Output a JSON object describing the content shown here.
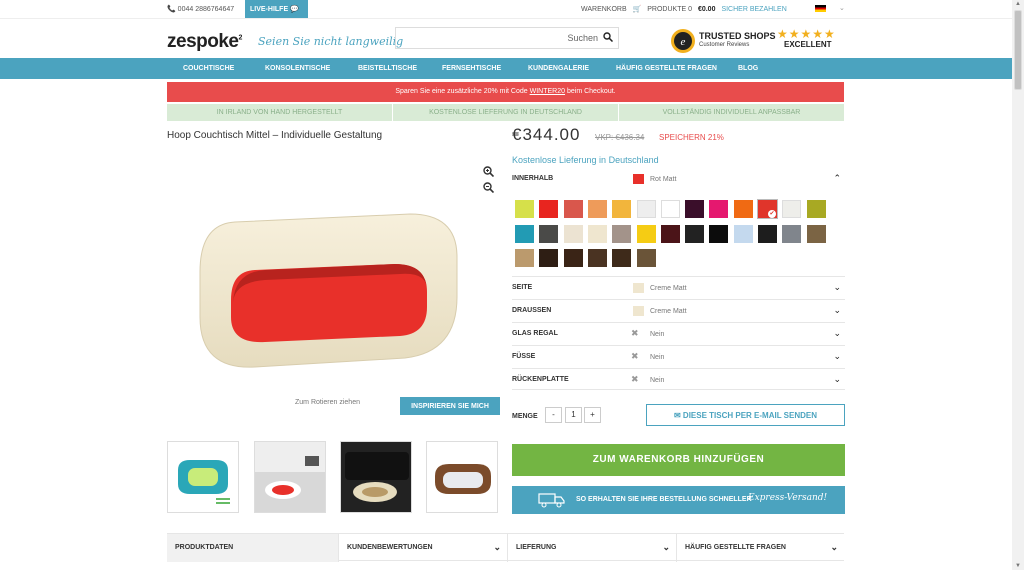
{
  "topbar": {
    "phone": "0044 2886764647",
    "live_label": "LIVE-HILFE",
    "cart_label": "WARENKORB",
    "products_label": "PRODUKTE 0",
    "total": "€0.00",
    "checkout_label": "SICHER BEZAHLEN"
  },
  "header": {
    "logo": "zespoke",
    "tagline": "Seien Sie nicht langweilig",
    "search_placeholder": "Suchen",
    "trusted_title": "TRUSTED SHOPS",
    "trusted_sub": "Customer Reviews",
    "stars": "★★★★★",
    "rating": "EXCELLENT"
  },
  "nav": [
    "COUCHTISCHE",
    "KONSOLENTISCHE",
    "BEISTELLTISCHE",
    "FERNSEHTISCHE",
    "KUNDENGALERIE",
    "HÄUFIG GESTELLTE FRAGEN",
    "BLOG"
  ],
  "promo": {
    "before": "Sparen Sie eine zusätzliche 20% mit Code ",
    "code": "WINTER20",
    "after": " beim Checkout."
  },
  "usps": [
    "IN IRLAND VON HAND HERGESTELLT",
    "KOSTENLOSE LIEFERUNG IN DEUTSCHLAND",
    "VOLLSTÄNDIG INDIVIDUELL ANPASSBAR"
  ],
  "product": {
    "title": "Hoop Couchtisch Mittel – Individuelle Gestaltung",
    "rotate_hint": "Zum Rotieren ziehen",
    "inspire_label": "INSPIRIEREN SIE MICH",
    "price": "€344.00",
    "old_price": "VKP: €436.34",
    "saving": "SPEICHERN 21%",
    "free_shipping": "Kostenlose Lieferung in Deutschland"
  },
  "options": {
    "innerhalb": {
      "label": "INNERHALB",
      "value": "Rot Matt",
      "color": "#e8302a"
    },
    "seite": {
      "label": "SEITE",
      "value": "Creme Matt",
      "color": "#efe6cf"
    },
    "draussen": {
      "label": "DRAUSSEN",
      "value": "Creme Matt",
      "color": "#efe6cf"
    },
    "glas": {
      "label": "GLAS REGAL",
      "value": "Nein"
    },
    "fuesse": {
      "label": "FÜSSE",
      "value": "Nein"
    },
    "rueckenplatte": {
      "label": "RÜCKENPLATTE",
      "value": "Nein"
    }
  },
  "swatches": [
    "#d6e04a",
    "#e8251f",
    "#d9574c",
    "#ee9b5a",
    "#f2b53c",
    "#eeeeee",
    "#ffffff",
    "#3a0e2a",
    "#e5186f",
    "#f06a13",
    "#e0352b",
    "#eeeeea",
    "#a8a923",
    "#229bb4",
    "#4a4a48",
    "#ece3d2",
    "#efe6cf",
    "#a3938a",
    "#f5cc14",
    "#4b1418",
    "#222222",
    "#0c0c0c",
    "#c4d9ee",
    "#1d1d1d",
    "#80858c",
    "#7b6444",
    "#bb9a6d",
    "#2e1e14",
    "#3a2416",
    "#4a3322",
    "#3e2a1a",
    "#6a5438"
  ],
  "quantity": {
    "label": "MENGE",
    "minus": "-",
    "value": "1",
    "plus": "+"
  },
  "email_label": "DIESE TISCH PER E-MAIL SENDEN",
  "cart_button": "ZUM WARENKORB HINZUFÜGEN",
  "express": {
    "text": "SO ERHALTEN SIE IHRE BESTELLUNG SCHNELLER",
    "script": "Express-Versand!"
  },
  "tabs": [
    "PRODUKTDATEN",
    "KUNDENBEWERTUNGEN",
    "LIEFERUNG",
    "HÄUFIG GESTELLTE FRAGEN"
  ],
  "colors": {
    "accent": "#4ba3bf",
    "promo": "#e84c4c",
    "cart": "#73b543"
  }
}
